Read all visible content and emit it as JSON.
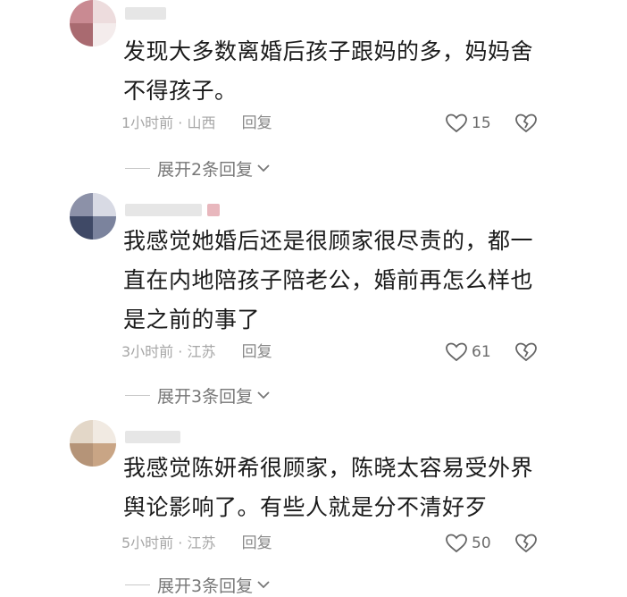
{
  "comments": [
    {
      "text_lines": [
        "发现大多数离婚后孩子跟妈的多，妈妈舍",
        "不得孩子。"
      ],
      "time": "1小时前",
      "location": "山西",
      "reply_label": "回复",
      "likes": "15",
      "expand_label": "展开2条回复"
    },
    {
      "text_lines": [
        "我感觉她婚后还是很顾家很尽责的，都一",
        "直在内地陪孩子陪老公，婚前再怎么样也",
        "是之前的事了"
      ],
      "time": "3小时前",
      "location": "江苏",
      "reply_label": "回复",
      "likes": "61",
      "expand_label": "展开3条回复"
    },
    {
      "text_lines": [
        "我感觉陈妍希很顾家，陈晓太容易受外界",
        "舆论影响了。有些人就是分不清好歹"
      ],
      "time": "5小时前",
      "location": "江苏",
      "reply_label": "回复",
      "likes": "50",
      "expand_label": "展开3条回复"
    }
  ],
  "meta_separator": "·",
  "icons": {
    "like": "heart-outline-icon",
    "dislike": "broken-heart-icon",
    "expand": "chevron-down-icon"
  },
  "colors": {
    "text": "#1b1b1b",
    "meta": "#a6a6a6",
    "icon": "#666666"
  }
}
